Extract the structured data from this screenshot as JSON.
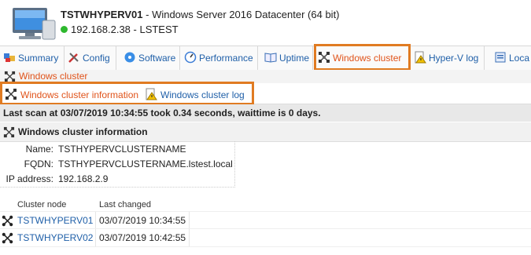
{
  "header": {
    "hostname": "TSTWHYPERV01",
    "os": " - Windows Server 2016 Datacenter (64 bit)",
    "ip_line": "192.168.2.38 - LSTEST",
    "status_color": "#2eb82e"
  },
  "tabs": [
    {
      "label": "Summary",
      "icon": "summary-icon"
    },
    {
      "label": "Config",
      "icon": "config-tools-icon"
    },
    {
      "label": "Software",
      "icon": "software-icon"
    },
    {
      "label": "Performance",
      "icon": "performance-gauge-icon"
    },
    {
      "label": "Uptime",
      "icon": "uptime-book-icon"
    },
    {
      "label": "Windows cluster",
      "icon": "cluster-icon",
      "active": true
    },
    {
      "label": "Hyper-V log",
      "icon": "warning-log-icon"
    },
    {
      "label": "Loca",
      "icon": "local-icon"
    }
  ],
  "breadcrumb": {
    "label": "Windows cluster"
  },
  "subtabs": [
    {
      "label": "Windows cluster information",
      "active": true
    },
    {
      "label": "Windows cluster log"
    }
  ],
  "scan_status": "Last scan at 03/07/2019 10:34:55 took 0.34 seconds, waittime is 0 days.",
  "section_title": "Windows cluster information",
  "info": {
    "name_label": "Name:",
    "name_value": "TSTHYPERVCLUSTERNAME",
    "fqdn_label": "FQDN:",
    "fqdn_value": "TSTHYPERVCLUSTERNAME.lstest.local",
    "ip_label": "IP address:",
    "ip_value": "192.168.2.9"
  },
  "table": {
    "headers": [
      "Cluster node",
      "Last changed"
    ],
    "rows": [
      {
        "node": "TSTWHYPERV01",
        "changed": "03/07/2019 10:34:55"
      },
      {
        "node": "TSTWHYPERV02",
        "changed": "03/07/2019 10:42:55"
      }
    ]
  },
  "colors": {
    "accent": "#e0531a",
    "link": "#1f5fa8",
    "highlight": "#e07b22"
  }
}
